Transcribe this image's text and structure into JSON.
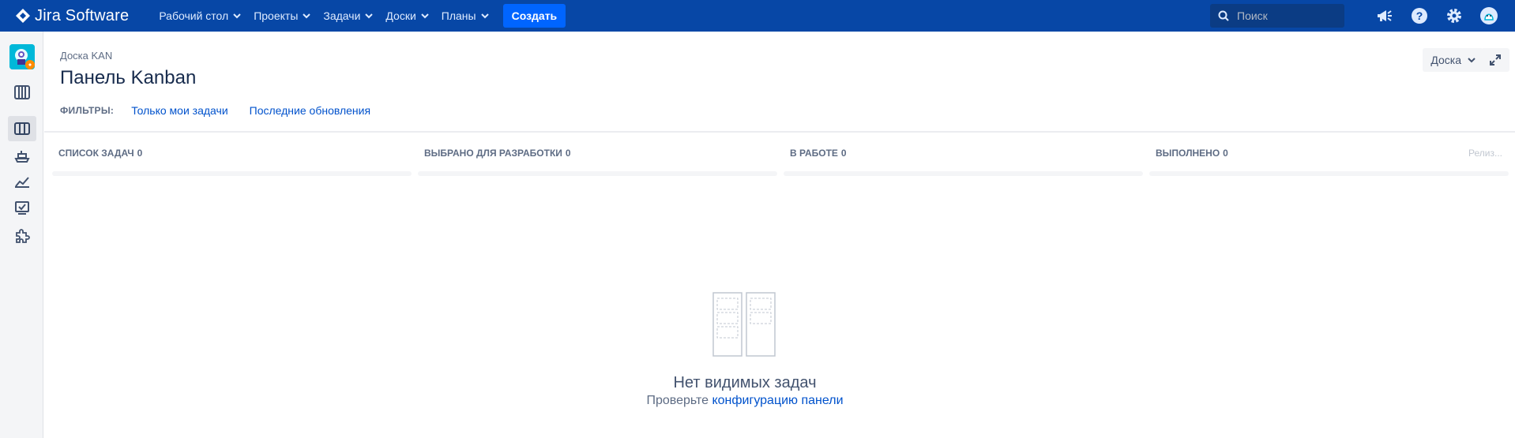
{
  "app": {
    "logo_text": "Jira Software"
  },
  "topnav": {
    "menu": [
      {
        "label": "Рабочий стол"
      },
      {
        "label": "Проекты"
      },
      {
        "label": "Задачи"
      },
      {
        "label": "Доски"
      },
      {
        "label": "Планы"
      }
    ],
    "create_label": "Создать",
    "search_placeholder": "Поиск",
    "icons": [
      "megaphone-icon",
      "help-icon",
      "settings-icon",
      "profile-avatar"
    ]
  },
  "sidebar": {
    "items": [
      "project-avatar",
      "backlog-icon",
      "board-icon",
      "releases-icon",
      "reports-icon",
      "issues-icon",
      "add-ons-icon"
    ],
    "active": "board-icon"
  },
  "page": {
    "breadcrumb": "Доска KAN",
    "title": "Панель Kanban",
    "board_button": "Доска"
  },
  "filters": {
    "label": "ФИЛЬТРЫ:",
    "items": [
      "Только мои задачи",
      "Последние обновления"
    ]
  },
  "columns": [
    {
      "title": "Список задач",
      "count": "0"
    },
    {
      "title": "Выбрано для разработки",
      "count": "0"
    },
    {
      "title": "В работе",
      "count": "0"
    },
    {
      "title": "Выполнено",
      "count": "0"
    }
  ],
  "release_label": "Релиз...",
  "empty_state": {
    "title": "Нет видимых задач",
    "subtitle_prefix": "Проверьте",
    "subtitle_link": "конфигурацию панели"
  },
  "colors": {
    "nav": "#0747a6",
    "primary": "#0065ff",
    "link": "#0052cc"
  }
}
